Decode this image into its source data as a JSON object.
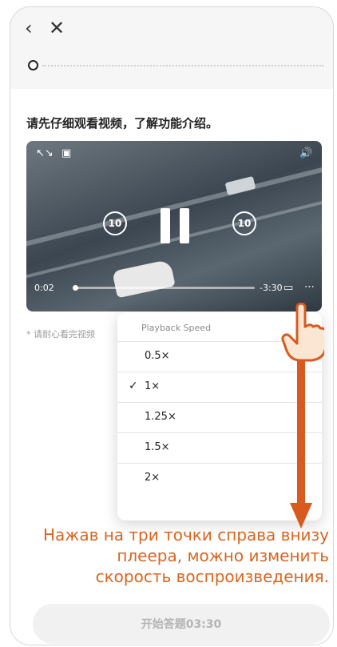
{
  "nav": {
    "back_icon": "chevron-left-icon",
    "close_icon": "close-icon"
  },
  "instruction": "请先仔细观看视频，了解功能介绍。",
  "video": {
    "current_time": "0:02",
    "remaining_time": "-3:30",
    "skip_back_label": "10",
    "skip_forward_label": "10",
    "icons": [
      "expand-icon",
      "picture-in-picture-icon",
      "volume-icon",
      "airplay-icon",
      "more-options-icon",
      "pause-icon"
    ]
  },
  "note": "* 请耐心看完视频",
  "speed_menu": {
    "title": "Playback Speed",
    "options": [
      "0.5×",
      "1×",
      "1.25×",
      "1.5×",
      "2×"
    ],
    "selected": "1×"
  },
  "bottom_button": {
    "label": "开始答题03:30"
  },
  "caption": "Нажав на три точки справа внизу плеера, можно изменить скорость воспроизведения.",
  "colors": {
    "annotation": "#d85a1e",
    "caption": "#d8661f"
  }
}
